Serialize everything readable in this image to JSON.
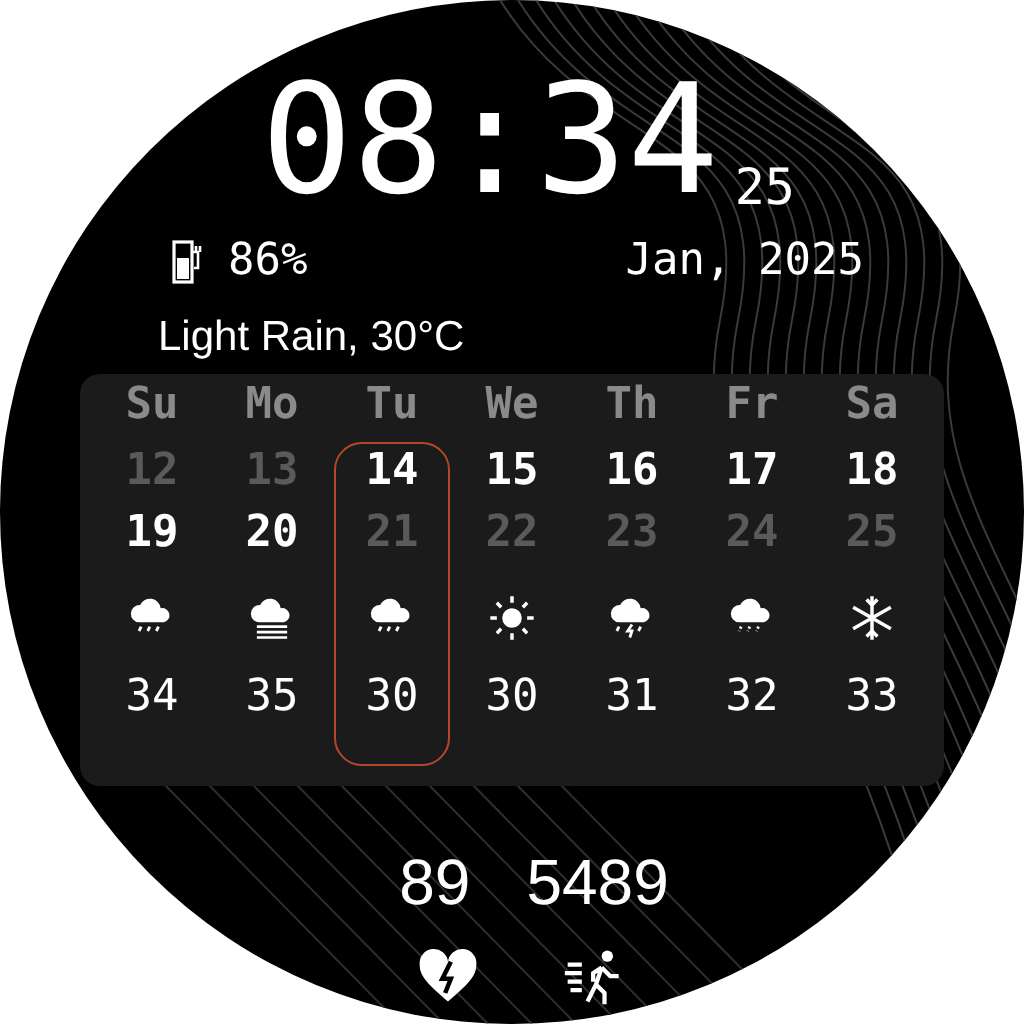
{
  "time": {
    "clock": "08:34",
    "seconds": "25"
  },
  "battery": {
    "reading": "86%"
  },
  "date": "Jan, 2025",
  "weather": "Light Rain, 30°C",
  "calendar": {
    "days": [
      {
        "label": "Su",
        "selected": false,
        "dates": [
          {
            "text": "12",
            "dim": true
          },
          {
            "text": "19",
            "dim": false
          }
        ],
        "kind": "rain",
        "temp": "34"
      },
      {
        "label": "Mo",
        "selected": false,
        "dates": [
          {
            "text": "13",
            "dim": true
          },
          {
            "text": "20",
            "dim": false
          }
        ],
        "kind": "fog",
        "temp": "35"
      },
      {
        "label": "Tu",
        "selected": true,
        "dates": [
          {
            "text": "14",
            "dim": false
          },
          {
            "text": "21",
            "dim": true
          }
        ],
        "kind": "rain",
        "temp": "30"
      },
      {
        "label": "We",
        "selected": false,
        "dates": [
          {
            "text": "15",
            "dim": false
          },
          {
            "text": "22",
            "dim": true
          }
        ],
        "kind": "sun",
        "temp": "30"
      },
      {
        "label": "Th",
        "selected": false,
        "dates": [
          {
            "text": "16",
            "dim": false
          },
          {
            "text": "23",
            "dim": true
          }
        ],
        "kind": "thunder",
        "temp": "31"
      },
      {
        "label": "Fr",
        "selected": false,
        "dates": [
          {
            "text": "17",
            "dim": false
          },
          {
            "text": "24",
            "dim": true
          }
        ],
        "kind": "sleet",
        "temp": "32"
      },
      {
        "label": "Sa",
        "selected": false,
        "dates": [
          {
            "text": "18",
            "dim": false
          },
          {
            "text": "25",
            "dim": true
          }
        ],
        "kind": "snow",
        "temp": "33"
      }
    ]
  },
  "heart_rate": "89",
  "steps": "5489"
}
